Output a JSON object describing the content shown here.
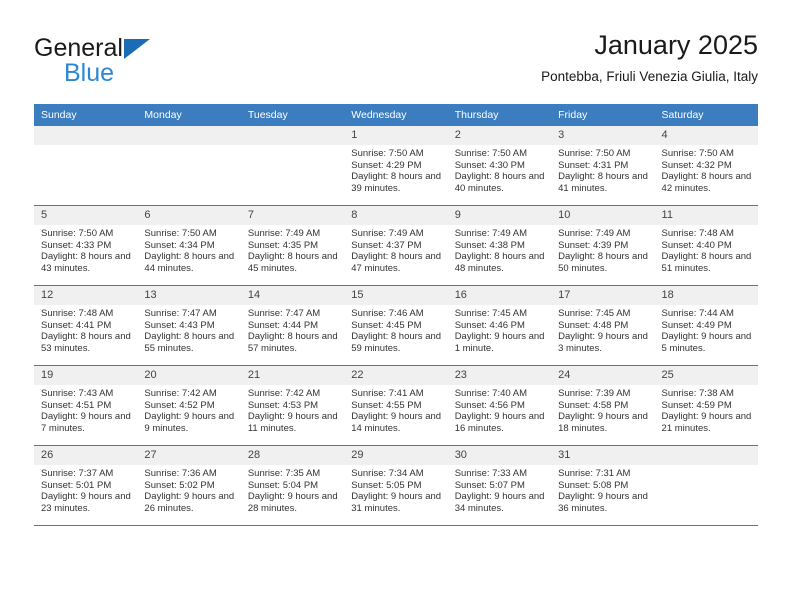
{
  "brand": {
    "name_top": "General",
    "name_bottom": "Blue",
    "accent_color": "#2b87d2",
    "triangle_color": "#1b6cb5"
  },
  "header": {
    "title": "January 2025",
    "subtitle": "Pontebba, Friuli Venezia Giulia, Italy"
  },
  "calendar": {
    "header_bg": "#3b7dbf",
    "daynum_bg": "#f0f0f0",
    "weekdays": [
      "Sunday",
      "Monday",
      "Tuesday",
      "Wednesday",
      "Thursday",
      "Friday",
      "Saturday"
    ],
    "labels": {
      "sunrise": "Sunrise:",
      "sunset": "Sunset:",
      "daylight": "Daylight:"
    },
    "weeks": [
      [
        {
          "day": "",
          "empty": true
        },
        {
          "day": "",
          "empty": true
        },
        {
          "day": "",
          "empty": true
        },
        {
          "day": "1",
          "sunrise": "Sunrise: 7:50 AM",
          "sunset": "Sunset: 4:29 PM",
          "daylight": "Daylight: 8 hours and 39 minutes."
        },
        {
          "day": "2",
          "sunrise": "Sunrise: 7:50 AM",
          "sunset": "Sunset: 4:30 PM",
          "daylight": "Daylight: 8 hours and 40 minutes."
        },
        {
          "day": "3",
          "sunrise": "Sunrise: 7:50 AM",
          "sunset": "Sunset: 4:31 PM",
          "daylight": "Daylight: 8 hours and 41 minutes."
        },
        {
          "day": "4",
          "sunrise": "Sunrise: 7:50 AM",
          "sunset": "Sunset: 4:32 PM",
          "daylight": "Daylight: 8 hours and 42 minutes."
        }
      ],
      [
        {
          "day": "5",
          "sunrise": "Sunrise: 7:50 AM",
          "sunset": "Sunset: 4:33 PM",
          "daylight": "Daylight: 8 hours and 43 minutes."
        },
        {
          "day": "6",
          "sunrise": "Sunrise: 7:50 AM",
          "sunset": "Sunset: 4:34 PM",
          "daylight": "Daylight: 8 hours and 44 minutes."
        },
        {
          "day": "7",
          "sunrise": "Sunrise: 7:49 AM",
          "sunset": "Sunset: 4:35 PM",
          "daylight": "Daylight: 8 hours and 45 minutes."
        },
        {
          "day": "8",
          "sunrise": "Sunrise: 7:49 AM",
          "sunset": "Sunset: 4:37 PM",
          "daylight": "Daylight: 8 hours and 47 minutes."
        },
        {
          "day": "9",
          "sunrise": "Sunrise: 7:49 AM",
          "sunset": "Sunset: 4:38 PM",
          "daylight": "Daylight: 8 hours and 48 minutes."
        },
        {
          "day": "10",
          "sunrise": "Sunrise: 7:49 AM",
          "sunset": "Sunset: 4:39 PM",
          "daylight": "Daylight: 8 hours and 50 minutes."
        },
        {
          "day": "11",
          "sunrise": "Sunrise: 7:48 AM",
          "sunset": "Sunset: 4:40 PM",
          "daylight": "Daylight: 8 hours and 51 minutes."
        }
      ],
      [
        {
          "day": "12",
          "sunrise": "Sunrise: 7:48 AM",
          "sunset": "Sunset: 4:41 PM",
          "daylight": "Daylight: 8 hours and 53 minutes."
        },
        {
          "day": "13",
          "sunrise": "Sunrise: 7:47 AM",
          "sunset": "Sunset: 4:43 PM",
          "daylight": "Daylight: 8 hours and 55 minutes."
        },
        {
          "day": "14",
          "sunrise": "Sunrise: 7:47 AM",
          "sunset": "Sunset: 4:44 PM",
          "daylight": "Daylight: 8 hours and 57 minutes."
        },
        {
          "day": "15",
          "sunrise": "Sunrise: 7:46 AM",
          "sunset": "Sunset: 4:45 PM",
          "daylight": "Daylight: 8 hours and 59 minutes."
        },
        {
          "day": "16",
          "sunrise": "Sunrise: 7:45 AM",
          "sunset": "Sunset: 4:46 PM",
          "daylight": "Daylight: 9 hours and 1 minute."
        },
        {
          "day": "17",
          "sunrise": "Sunrise: 7:45 AM",
          "sunset": "Sunset: 4:48 PM",
          "daylight": "Daylight: 9 hours and 3 minutes."
        },
        {
          "day": "18",
          "sunrise": "Sunrise: 7:44 AM",
          "sunset": "Sunset: 4:49 PM",
          "daylight": "Daylight: 9 hours and 5 minutes."
        }
      ],
      [
        {
          "day": "19",
          "sunrise": "Sunrise: 7:43 AM",
          "sunset": "Sunset: 4:51 PM",
          "daylight": "Daylight: 9 hours and 7 minutes."
        },
        {
          "day": "20",
          "sunrise": "Sunrise: 7:42 AM",
          "sunset": "Sunset: 4:52 PM",
          "daylight": "Daylight: 9 hours and 9 minutes."
        },
        {
          "day": "21",
          "sunrise": "Sunrise: 7:42 AM",
          "sunset": "Sunset: 4:53 PM",
          "daylight": "Daylight: 9 hours and 11 minutes."
        },
        {
          "day": "22",
          "sunrise": "Sunrise: 7:41 AM",
          "sunset": "Sunset: 4:55 PM",
          "daylight": "Daylight: 9 hours and 14 minutes."
        },
        {
          "day": "23",
          "sunrise": "Sunrise: 7:40 AM",
          "sunset": "Sunset: 4:56 PM",
          "daylight": "Daylight: 9 hours and 16 minutes."
        },
        {
          "day": "24",
          "sunrise": "Sunrise: 7:39 AM",
          "sunset": "Sunset: 4:58 PM",
          "daylight": "Daylight: 9 hours and 18 minutes."
        },
        {
          "day": "25",
          "sunrise": "Sunrise: 7:38 AM",
          "sunset": "Sunset: 4:59 PM",
          "daylight": "Daylight: 9 hours and 21 minutes."
        }
      ],
      [
        {
          "day": "26",
          "sunrise": "Sunrise: 7:37 AM",
          "sunset": "Sunset: 5:01 PM",
          "daylight": "Daylight: 9 hours and 23 minutes."
        },
        {
          "day": "27",
          "sunrise": "Sunrise: 7:36 AM",
          "sunset": "Sunset: 5:02 PM",
          "daylight": "Daylight: 9 hours and 26 minutes."
        },
        {
          "day": "28",
          "sunrise": "Sunrise: 7:35 AM",
          "sunset": "Sunset: 5:04 PM",
          "daylight": "Daylight: 9 hours and 28 minutes."
        },
        {
          "day": "29",
          "sunrise": "Sunrise: 7:34 AM",
          "sunset": "Sunset: 5:05 PM",
          "daylight": "Daylight: 9 hours and 31 minutes."
        },
        {
          "day": "30",
          "sunrise": "Sunrise: 7:33 AM",
          "sunset": "Sunset: 5:07 PM",
          "daylight": "Daylight: 9 hours and 34 minutes."
        },
        {
          "day": "31",
          "sunrise": "Sunrise: 7:31 AM",
          "sunset": "Sunset: 5:08 PM",
          "daylight": "Daylight: 9 hours and 36 minutes."
        },
        {
          "day": "",
          "empty": true
        }
      ]
    ]
  }
}
